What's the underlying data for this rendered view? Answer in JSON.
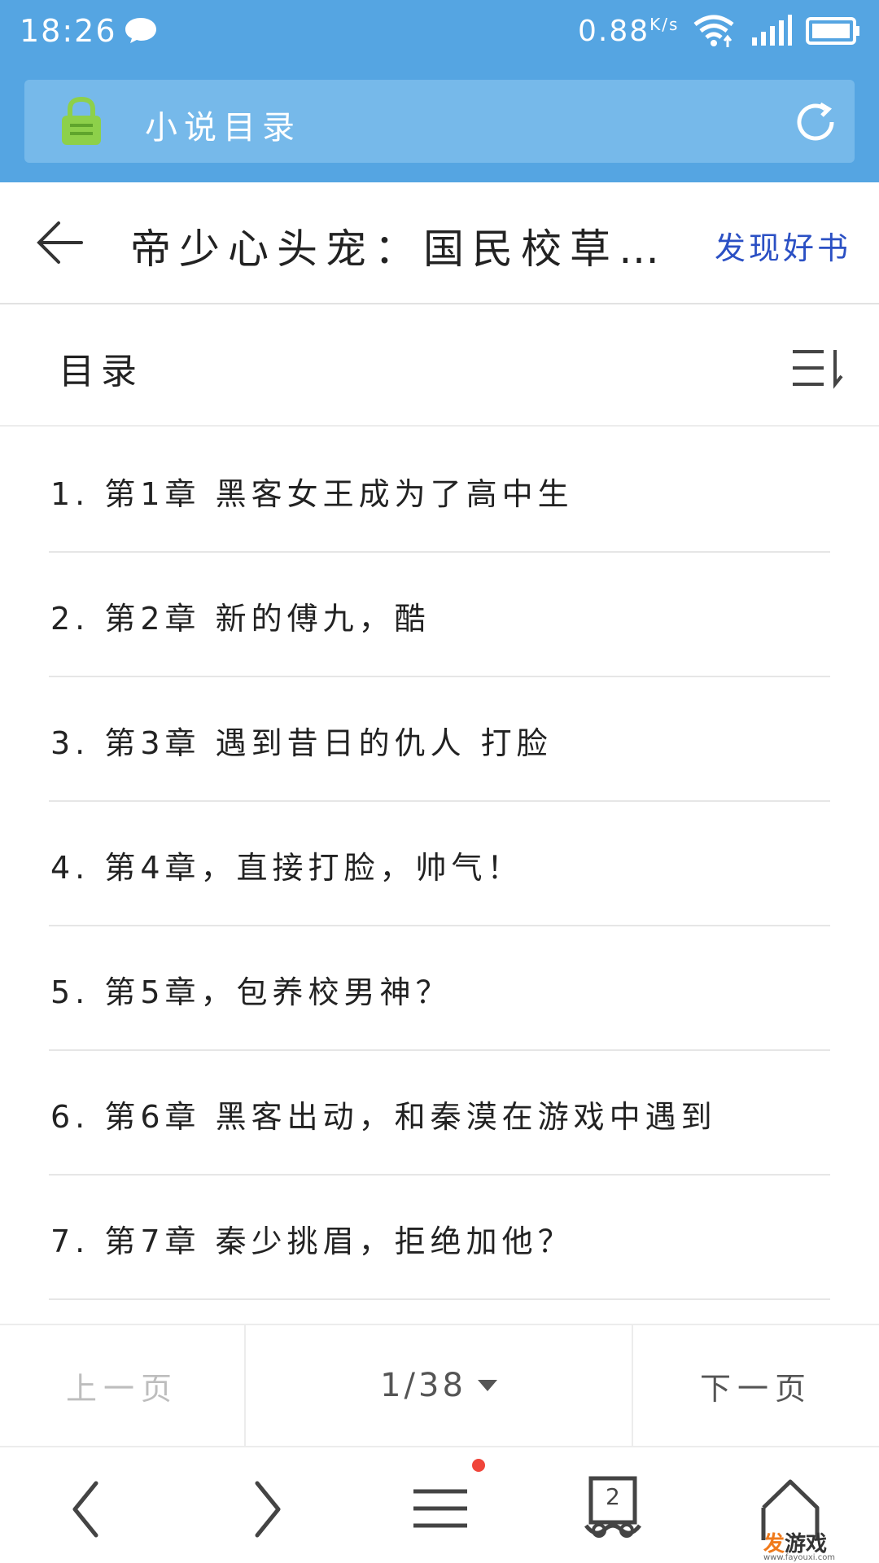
{
  "status_bar": {
    "time": "18:26",
    "speed": "0.88",
    "speed_unit": "K/s",
    "icons": [
      "message-icon",
      "wifi-icon",
      "signal-icon",
      "battery-icon"
    ]
  },
  "address_bar": {
    "text": "小说目录",
    "icons": [
      "lock-icon",
      "refresh-icon"
    ],
    "lock_color": "#8dd04a"
  },
  "title_bar": {
    "title": "帝少心头宠：国民校草…",
    "discover_label": "发现好书",
    "discover_color": "#2b50c4"
  },
  "toc": {
    "label": "目录"
  },
  "chapters": [
    "1. 第1章 黑客女王成为了高中生",
    "2. 第2章 新的傅九，酷",
    "3. 第3章 遇到昔日的仇人 打脸",
    "4. 第4章，直接打脸，帅气！",
    "5. 第5章，包养校男神？",
    "6. 第6章 黑客出动，和秦漠在游戏中遇到",
    "7. 第7章 秦少挑眉，拒绝加他？"
  ],
  "pager": {
    "prev_label": "上一页",
    "page": "1/38",
    "next_label": "下一页"
  },
  "bottom_nav": {
    "tab_count": "2",
    "items": [
      "back-icon",
      "forward-icon",
      "menu-icon",
      "tabs-icon",
      "home-icon"
    ]
  },
  "watermark": {
    "brand_accent": "发",
    "brand_rest": "游戏",
    "url": "www.fayouxi.com"
  },
  "colors": {
    "header_blue": "#55a5e2",
    "address_blue": "#76b9ea",
    "notification_dot": "#f0453a"
  }
}
